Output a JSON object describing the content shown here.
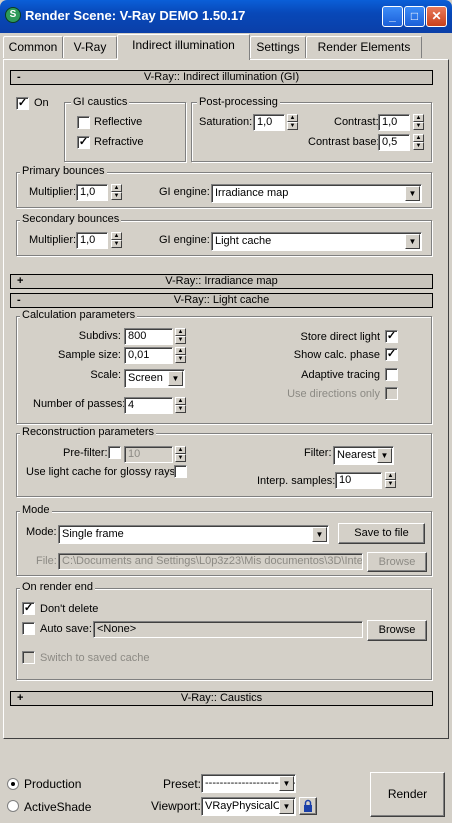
{
  "window": {
    "title": "Render Scene: V-Ray DEMO 1.50.17",
    "minimize": "_",
    "maximize": "□",
    "close": "✕"
  },
  "tabs": [
    "Common",
    "V-Ray",
    "Indirect illumination",
    "Settings",
    "Render Elements"
  ],
  "gi": {
    "rollout_title": "V-Ray:: Indirect illumination (GI)",
    "rollout_sign": "-",
    "on_label": "On",
    "on_checked": true,
    "caustics": {
      "title": "GI caustics",
      "reflective": "Reflective",
      "reflective_checked": false,
      "refractive": "Refractive",
      "refractive_checked": true
    },
    "post": {
      "title": "Post-processing",
      "saturation_label": "Saturation:",
      "saturation": "1,0",
      "contrast_label": "Contrast:",
      "contrast": "1,0",
      "contrast_base_label": "Contrast base:",
      "contrast_base": "0,5"
    },
    "primary": {
      "title": "Primary bounces",
      "multiplier_label": "Multiplier:",
      "multiplier": "1,0",
      "engine_label": "GI engine:",
      "engine": "Irradiance map"
    },
    "secondary": {
      "title": "Secondary bounces",
      "multiplier_label": "Multiplier:",
      "multiplier": "1,0",
      "engine_label": "GI engine:",
      "engine": "Light cache"
    }
  },
  "irradiance": {
    "rollout_title": "V-Ray:: Irradiance map",
    "rollout_sign": "+"
  },
  "lightcache": {
    "rollout_title": "V-Ray:: Light cache",
    "rollout_sign": "-",
    "calc": {
      "title": "Calculation parameters",
      "subdivs_label": "Subdivs:",
      "subdivs": "800",
      "sample_size_label": "Sample size:",
      "sample_size": "0,01",
      "scale_label": "Scale:",
      "scale": "Screen",
      "passes_label": "Number of passes:",
      "passes": "4",
      "store_direct": "Store direct light",
      "store_direct_checked": true,
      "show_calc": "Show calc. phase",
      "show_calc_checked": true,
      "adaptive": "Adaptive tracing",
      "adaptive_checked": false,
      "use_dirs": "Use directions only",
      "use_dirs_checked": false
    },
    "recon": {
      "title": "Reconstruction parameters",
      "prefilter_label": "Pre-filter:",
      "prefilter_checked": false,
      "prefilter": "10",
      "glossy_label": "Use light cache for glossy rays",
      "glossy_checked": false,
      "filter_label": "Filter:",
      "filter": "Nearest",
      "interp_label": "Interp. samples:",
      "interp": "10"
    },
    "mode": {
      "title": "Mode",
      "mode_label": "Mode:",
      "mode": "Single frame",
      "save_button": "Save to file",
      "file_label": "File:",
      "file": "C:\\Documents and Settings\\L0p3z23\\Mis documentos\\3D\\Inte",
      "browse_button": "Browse"
    },
    "end": {
      "title": "On render end",
      "dont_delete": "Don't delete",
      "dont_delete_checked": true,
      "auto_save": "Auto save:",
      "auto_save_checked": false,
      "auto_save_value": "<None>",
      "browse_button": "Browse",
      "switch": "Switch to saved cache",
      "switch_checked": false
    }
  },
  "caustics": {
    "rollout_title": "V-Ray:: Caustics",
    "rollout_sign": "+"
  },
  "footer": {
    "production": "Production",
    "activeshade": "ActiveShade",
    "preset_label": "Preset:",
    "preset": "--------------------------",
    "viewport_label": "Viewport:",
    "viewport": "VRayPhysicalCa",
    "render_button": "Render",
    "lock_icon": "lock-icon"
  }
}
